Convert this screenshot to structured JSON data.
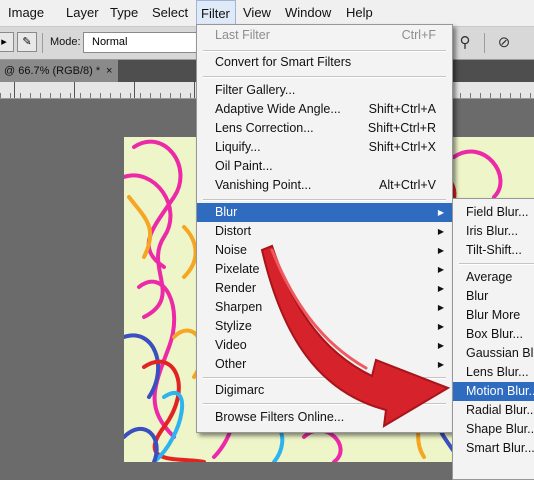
{
  "menubar": {
    "items": [
      {
        "label": "Image"
      },
      {
        "label": "Layer"
      },
      {
        "label": "Type"
      },
      {
        "label": "Select"
      },
      {
        "label": "Filter"
      },
      {
        "label": "View"
      },
      {
        "label": "Window"
      },
      {
        "label": "Help"
      }
    ],
    "active": "Filter"
  },
  "options_bar": {
    "mode_label": "Mode:",
    "mode_value": "Normal"
  },
  "document_tab": {
    "title": "@ 66.7% (RGB/8) *",
    "close": "×"
  },
  "filter_menu": {
    "last_filter": {
      "label": "Last Filter",
      "shortcut": "Ctrl+F"
    },
    "convert_smart": "Convert for Smart Filters",
    "group1": [
      {
        "label": "Filter Gallery...",
        "shortcut": ""
      },
      {
        "label": "Adaptive Wide Angle...",
        "shortcut": "Shift+Ctrl+A"
      },
      {
        "label": "Lens Correction...",
        "shortcut": "Shift+Ctrl+R"
      },
      {
        "label": "Liquify...",
        "shortcut": "Shift+Ctrl+X"
      },
      {
        "label": "Oil Paint...",
        "shortcut": ""
      },
      {
        "label": "Vanishing Point...",
        "shortcut": "Alt+Ctrl+V"
      }
    ],
    "submenus": [
      {
        "label": "Blur"
      },
      {
        "label": "Distort"
      },
      {
        "label": "Noise"
      },
      {
        "label": "Pixelate"
      },
      {
        "label": "Render"
      },
      {
        "label": "Sharpen"
      },
      {
        "label": "Stylize"
      },
      {
        "label": "Video"
      },
      {
        "label": "Other"
      }
    ],
    "digimarc": "Digimarc",
    "browse_online": "Browse Filters Online..."
  },
  "blur_menu": {
    "group1": [
      "Field Blur...",
      "Iris Blur...",
      "Tilt-Shift..."
    ],
    "group2": [
      "Average",
      "Blur",
      "Blur More",
      "Box Blur...",
      "Gaussian Blur",
      "Lens Blur...",
      "Motion Blur...",
      "Radial Blur...",
      "Shape Blur...",
      "Smart Blur..."
    ],
    "highlighted": "Motion Blur..."
  },
  "icons": {
    "arrow": "red-curved-arrow-icon",
    "submenu": "submenu-arrow-icon"
  },
  "colors": {
    "highlight": "#2f6bbf",
    "arrow": "#d6222a",
    "canvas_bg": "#eef5c8"
  }
}
